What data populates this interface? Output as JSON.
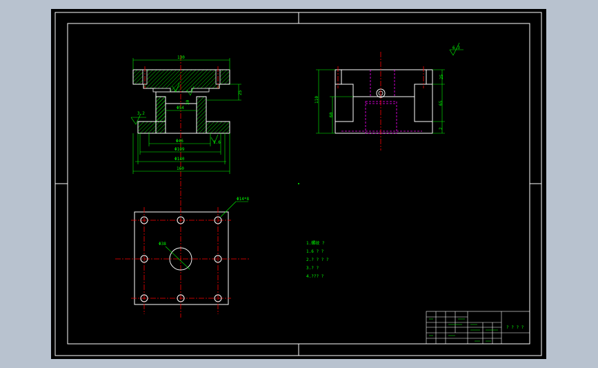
{
  "colors": {
    "workspace": "#b8c2cf",
    "paper": "#000000",
    "border": "#ffffff",
    "dimension": "#00ff00",
    "centerline": "#ff0000",
    "hidden": "#ff00ff",
    "hatch": "#00ff00"
  },
  "front_view": {
    "dims": {
      "top_width": "130",
      "height_right": "25",
      "inner_height": "30",
      "inner_diameter": "Φ54",
      "roughness_left": "3.2",
      "roughness_right": "1.6",
      "bore_46": "Φ46",
      "bore_109": "Φ109",
      "bore_140": "Φ140",
      "overall_width": "160"
    }
  },
  "side_view": {
    "dims": {
      "overall_height": "110",
      "mid_height": "60",
      "top_right": "25",
      "right_mid": "65",
      "bottom_right": "2",
      "roughness_top": "6.3"
    }
  },
  "plan_view": {
    "dims": {
      "holes_label": "Φ14*8",
      "center_bore": "Φ38"
    }
  },
  "notes": {
    "lines": [
      "1.螺纹 ?",
      "1.6 ? ?",
      "2.? ? ? ?",
      "3.? ?",
      "4.??? ?"
    ]
  },
  "title_block": {
    "title": "? ? ? ?"
  }
}
